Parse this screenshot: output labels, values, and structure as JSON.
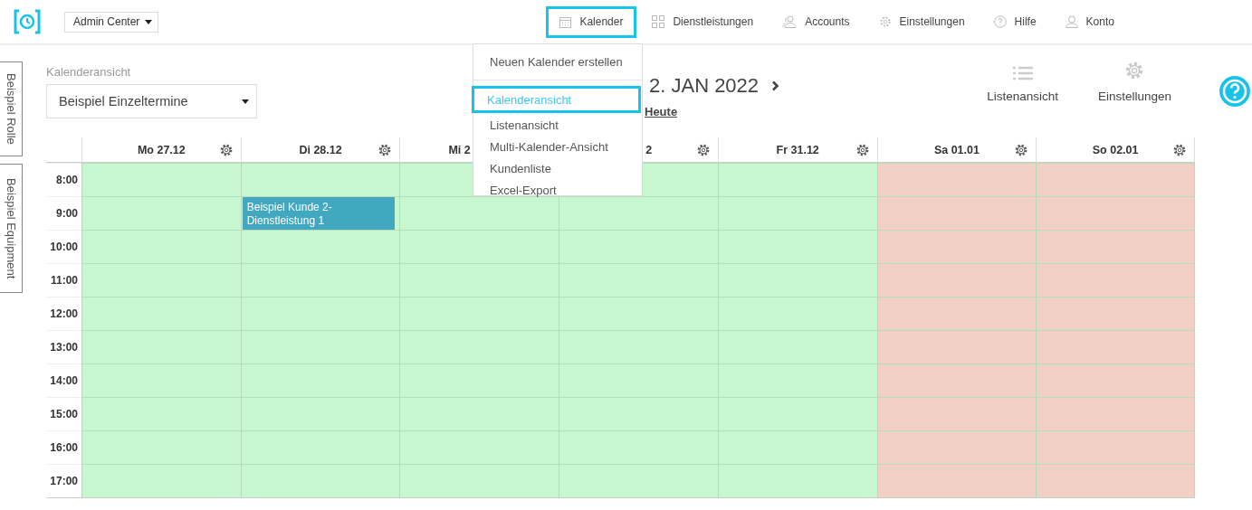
{
  "top_bar": {
    "app_switcher": "Admin Center",
    "nav": [
      {
        "label": "Kalender",
        "selected": true
      },
      {
        "label": "Dienstleistungen",
        "selected": false
      },
      {
        "label": "Accounts",
        "selected": false
      },
      {
        "label": "Einstellungen",
        "selected": false
      },
      {
        "label": "Hilfe",
        "selected": false
      },
      {
        "label": "Konto",
        "selected": false
      }
    ]
  },
  "calendar_menu": {
    "groups": [
      [
        {
          "label": "Neuen Kalender erstellen",
          "selected": false
        }
      ],
      [
        {
          "label": "Kalenderansicht",
          "selected": true
        },
        {
          "label": "Listenansicht",
          "selected": false
        },
        {
          "label": "Multi-Kalender-Ansicht",
          "selected": false
        },
        {
          "label": "Kundenliste",
          "selected": false
        },
        {
          "label": "Excel-Export",
          "selected": false
        }
      ]
    ]
  },
  "side_tabs": [
    "Beispiel Rolle",
    "Beispiel Equipment"
  ],
  "view_select": {
    "label": "Kalenderansicht",
    "value": "Beispiel Einzeltermine"
  },
  "date_range": {
    "title": "2. JAN 2022",
    "today": "Heute"
  },
  "toolbar": [
    "Listenansicht",
    "Einstellungen"
  ],
  "calendar": {
    "columns": [
      {
        "label": "Mo 27.12",
        "kind": "weekday"
      },
      {
        "label": "Di 28.12",
        "kind": "weekday"
      },
      {
        "label": "Mi 2",
        "kind": "weekday"
      },
      {
        "label": "2",
        "kind": "weekday"
      },
      {
        "label": "Fr 31.12",
        "kind": "weekday"
      },
      {
        "label": "Sa 01.01",
        "kind": "weekend"
      },
      {
        "label": "So 02.01",
        "kind": "weekend"
      }
    ],
    "rows": [
      {
        "time": "8:00"
      },
      {
        "time": "9:00",
        "cells": [
          {
            "kind": "free"
          },
          {
            "kind": "event",
            "text": "Beispiel Kunde 2-Dienstleistung 1"
          },
          {
            "kind": "free"
          },
          {
            "kind": "free"
          },
          {
            "kind": "free"
          },
          {
            "kind": "free"
          },
          {
            "kind": "free"
          }
        ]
      },
      {
        "time": "10:00"
      },
      {
        "time": "11:00"
      },
      {
        "time": "12:00"
      },
      {
        "time": "13:00"
      },
      {
        "time": "14:00"
      },
      {
        "time": "15:00"
      },
      {
        "time": "16:00"
      },
      {
        "time": "17:00"
      }
    ]
  }
}
